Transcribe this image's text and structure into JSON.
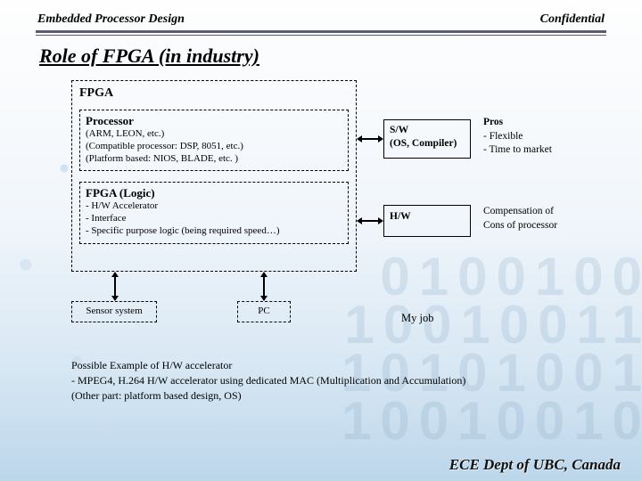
{
  "header": {
    "left": "Embedded Processor Design",
    "right": "Confidential"
  },
  "title": "Role of FPGA (in industry)",
  "fpga": {
    "label": "FPGA",
    "processor": {
      "title": "Processor",
      "line1": "(ARM, LEON, etc.)",
      "line2": "(Compatible processor: DSP, 8051, etc.)",
      "line3": "(Platform based: NIOS, BLADE, etc. )"
    },
    "logic": {
      "title": "FPGA (Logic)",
      "line1": "- H/W Accelerator",
      "line2": "- Interface",
      "line3": "- Specific purpose logic (being required speed…)"
    }
  },
  "sw": {
    "line1": "S/W",
    "line2": "(OS, Compiler)",
    "pros_title": "Pros",
    "pros_line1": "- Flexible",
    "pros_line2": "- Time to market"
  },
  "hw": {
    "label": "H/W",
    "pros_line1": "Compensation of",
    "pros_line2": "Cons of processor"
  },
  "sensor": "Sensor system",
  "pc": "PC",
  "myjob": "My job",
  "example": {
    "line1": "Possible Example of H/W accelerator",
    "line2": "- MPEG4, H.264 H/W accelerator using dedicated MAC (Multiplication and Accumulation)",
    "line3": " (Other part: platform based design, OS)"
  },
  "footer": "ECE Dept of UBC, Canada"
}
